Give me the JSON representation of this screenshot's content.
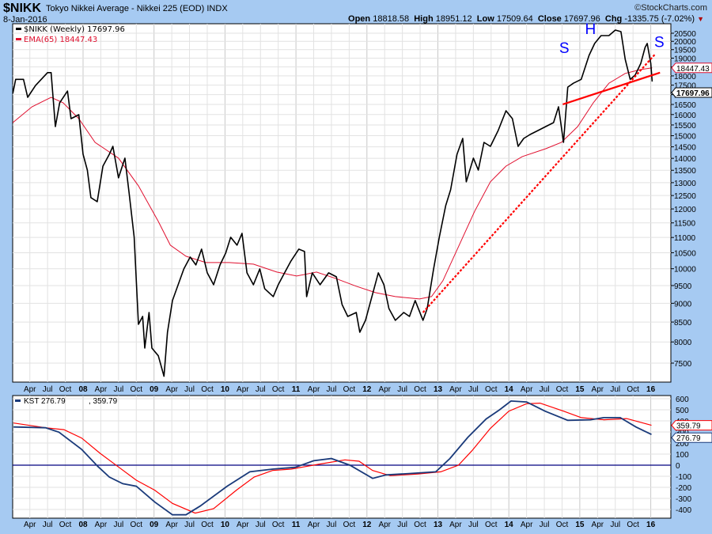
{
  "header": {
    "symbol": "$NIKK",
    "title": "Tokyo Nikkei Average - Nikkei 225 (EOD)  INDX",
    "brand": "©StockCharts.com",
    "date": "8-Jan-2016",
    "open_label": "Open",
    "open": "18818.58",
    "high_label": "High",
    "high": "18951.12",
    "low_label": "Low",
    "low": "17509.64",
    "close_label": "Close",
    "close": "17697.96",
    "chg_label": "Chg",
    "chg": "-1335.75 (-7.02%)",
    "chg_arrow": "▼"
  },
  "colors": {
    "price": "#000000",
    "ema": "#e0102f",
    "kst": "#1a3a7a",
    "kst_signal": "#ff0000",
    "trend": "#ff0000",
    "annot": "#0000ff",
    "frame": "#a6caf2"
  },
  "chart_data": [
    {
      "type": "line",
      "panel": "price",
      "scale": "log",
      "ylim": [
        7100,
        21000
      ],
      "xlim": [
        2007.0,
        2016.28
      ],
      "legend": [
        "$NIKK (Weekly) 17697.96",
        "EMA(65) 18447.43"
      ],
      "y_ticks": [
        "20500",
        "20000",
        "19500",
        "19000",
        "18500",
        "18000",
        "17500",
        "17000",
        "16500",
        "16000",
        "15500",
        "15000",
        "14500",
        "14000",
        "13500",
        "13000",
        "12500",
        "12000",
        "11500",
        "11000",
        "10500",
        "10000",
        "9500",
        "9000",
        "8500",
        "8000",
        "7500"
      ],
      "last_tags": {
        "ema": "18447.43",
        "price": "17697.96"
      },
      "series": [
        {
          "name": "$NIKK (Weekly)",
          "x": [
            2007.01,
            2007.05,
            2007.16,
            2007.22,
            2007.33,
            2007.5,
            2007.55,
            2007.61,
            2007.67,
            2007.78,
            2007.83,
            2007.94,
            2008.0,
            2008.06,
            2008.11,
            2008.2,
            2008.28,
            2008.37,
            2008.42,
            2008.5,
            2008.59,
            2008.65,
            2008.72,
            2008.78,
            2008.84,
            2008.87,
            2008.93,
            2008.97,
            2009.06,
            2009.14,
            2009.19,
            2009.26,
            2009.34,
            2009.42,
            2009.51,
            2009.59,
            2009.67,
            2009.75,
            2009.84,
            2009.93,
            2010.01,
            2010.08,
            2010.17,
            2010.24,
            2010.31,
            2010.4,
            2010.49,
            2010.56,
            2010.68,
            2010.75,
            2010.84,
            2010.93,
            2011.04,
            2011.12,
            2011.15,
            2011.23,
            2011.34,
            2011.46,
            2011.57,
            2011.65,
            2011.73,
            2011.85,
            2011.9,
            2011.98,
            2012.07,
            2012.16,
            2012.24,
            2012.31,
            2012.4,
            2012.52,
            2012.6,
            2012.68,
            2012.79,
            2012.85,
            2012.94,
            2013.02,
            2013.11,
            2013.18,
            2013.27,
            2013.35,
            2013.4,
            2013.5,
            2013.57,
            2013.65,
            2013.74,
            2013.85,
            2013.96,
            2014.05,
            2014.13,
            2014.21,
            2014.3,
            2014.41,
            2014.52,
            2014.63,
            2014.7,
            2014.77,
            2014.83,
            2014.91,
            2015.02,
            2015.13,
            2015.21,
            2015.3,
            2015.41,
            2015.5,
            2015.58,
            2015.64,
            2015.71,
            2015.78,
            2015.86,
            2015.92,
            2015.95,
            2016.0,
            2016.02
          ],
          "y": [
            17065,
            17811,
            17811,
            16861,
            17478,
            18180,
            18180,
            15424,
            16580,
            17188,
            15801,
            15992,
            14176,
            13509,
            12419,
            12270,
            13673,
            14176,
            14522,
            13191,
            14007,
            12570,
            11007,
            8441,
            8647,
            7852,
            8752,
            7852,
            7669,
            7205,
            8240,
            9075,
            9524,
            9995,
            10363,
            10116,
            10616,
            9875,
            9524,
            10116,
            10489,
            11007,
            10745,
            11139,
            9875,
            9524,
            9995,
            9410,
            9185,
            9524,
            9875,
            10239,
            10616,
            10540,
            9185,
            9875,
            9524,
            9875,
            9757,
            8966,
            8647,
            8752,
            8240,
            8544,
            9185,
            9875,
            9524,
            8858,
            8544,
            8752,
            8647,
            9075,
            8544,
            8858,
            9995,
            11007,
            12123,
            12722,
            14176,
            14876,
            13033,
            14007,
            13509,
            14698,
            14522,
            15239,
            16186,
            15801,
            14522,
            14876,
            15057,
            15239,
            15424,
            15611,
            16382,
            14698,
            17394,
            17603,
            17811,
            19163,
            19870,
            20353,
            20353,
            20699,
            20599,
            18933,
            17811,
            18050,
            18702,
            19630,
            19870,
            18702,
            17690
          ]
        },
        {
          "name": "EMA(65)",
          "x": [
            2007.01,
            2007.28,
            2007.55,
            2007.72,
            2007.94,
            2008.17,
            2008.5,
            2008.78,
            2009.06,
            2009.23,
            2009.45,
            2009.73,
            2010.06,
            2010.4,
            2010.73,
            2011.01,
            2011.29,
            2011.57,
            2011.85,
            2012.12,
            2012.4,
            2012.74,
            2012.91,
            2013.07,
            2013.3,
            2013.52,
            2013.74,
            2013.96,
            2014.19,
            2014.52,
            2014.74,
            2014.97,
            2015.19,
            2015.41,
            2015.64,
            2015.86,
            2016.02
          ],
          "y": [
            15611,
            16382,
            16861,
            16580,
            15801,
            14698,
            14007,
            12876,
            11550,
            10745,
            10389,
            10190,
            10190,
            10140,
            9900,
            9780,
            9900,
            9700,
            9480,
            9297,
            9185,
            9119,
            9185,
            9640,
            10745,
            11922,
            13033,
            13673,
            14075,
            14417,
            14698,
            15424,
            16580,
            17603,
            18137,
            18354,
            18447
          ]
        }
      ],
      "annotations": [
        {
          "type": "trendline",
          "style": "solid",
          "x": [
            2014.76,
            2016.13
          ],
          "y": [
            16503,
            18180
          ]
        },
        {
          "type": "trendline",
          "style": "dotted",
          "x": [
            2012.79,
            2016.06
          ],
          "y": [
            8752,
            19226
          ]
        },
        {
          "type": "text",
          "text": "S",
          "x": 2014.78,
          "y": 19300
        },
        {
          "type": "text",
          "text": "H",
          "x": 2015.15,
          "y": 20450
        },
        {
          "type": "text",
          "text": "S",
          "x": 2016.12,
          "y": 19650
        }
      ]
    },
    {
      "type": "line",
      "panel": "kst",
      "ylim": [
        -470,
        640
      ],
      "legend_name": "KST",
      "legend_value1": "276.79",
      "legend_value2": "359.79",
      "y_ticks": [
        "600",
        "500",
        "400",
        "300",
        "200",
        "100",
        "0",
        "-100",
        "-200",
        "-300",
        "-400"
      ],
      "last_tags": {
        "signal": "359.79",
        "kst": "276.79"
      },
      "series": [
        {
          "name": "KST",
          "x": [
            2007.02,
            2007.47,
            2007.66,
            2007.98,
            2008.21,
            2008.37,
            2008.56,
            2008.75,
            2009.01,
            2009.26,
            2009.45,
            2009.65,
            2010.03,
            2010.35,
            2010.67,
            2010.99,
            2011.25,
            2011.5,
            2011.76,
            2012.08,
            2012.27,
            2012.59,
            2012.97,
            2013.17,
            2013.42,
            2013.68,
            2013.87,
            2014.03,
            2014.25,
            2014.51,
            2014.83,
            2015.15,
            2015.34,
            2015.57,
            2015.79,
            2016.01
          ],
          "y": [
            345,
            338,
            298,
            143,
            -12,
            -107,
            -167,
            -190,
            -333,
            -448,
            -448,
            -369,
            -190,
            -60,
            -36,
            -19,
            40,
            60,
            0,
            -119,
            -88,
            -76,
            -60,
            60,
            250,
            417,
            500,
            579,
            571,
            488,
            405,
            410,
            429,
            429,
            345,
            277
          ]
        },
        {
          "name": "Signal",
          "x": [
            2007.02,
            2007.47,
            2007.73,
            2007.98,
            2008.24,
            2008.49,
            2008.75,
            2009.01,
            2009.26,
            2009.58,
            2009.84,
            2010.16,
            2010.41,
            2010.67,
            2010.93,
            2011.31,
            2011.69,
            2011.89,
            2012.08,
            2012.33,
            2012.72,
            2013.04,
            2013.29,
            2013.48,
            2013.74,
            2014.0,
            2014.25,
            2014.44,
            2014.77,
            2015.02,
            2015.34,
            2015.66,
            2016.01
          ],
          "y": [
            381,
            338,
            321,
            245,
            107,
            -12,
            -136,
            -226,
            -345,
            -433,
            -393,
            -226,
            -107,
            -48,
            -36,
            7,
            48,
            36,
            -48,
            -95,
            -79,
            -60,
            0,
            131,
            333,
            488,
            555,
            560,
            488,
            429,
            410,
            421,
            360
          ]
        }
      ]
    }
  ],
  "x_ticks": [
    {
      "label": "Apr",
      "t": 2007.25
    },
    {
      "label": "Jul",
      "t": 2007.5
    },
    {
      "label": "Oct",
      "t": 2007.75
    },
    {
      "label": "08",
      "t": 2008,
      "year": true
    },
    {
      "label": "Apr",
      "t": 2008.25
    },
    {
      "label": "Jul",
      "t": 2008.5
    },
    {
      "label": "Oct",
      "t": 2008.75
    },
    {
      "label": "09",
      "t": 2009,
      "year": true
    },
    {
      "label": "Apr",
      "t": 2009.25
    },
    {
      "label": "Jul",
      "t": 2009.5
    },
    {
      "label": "Oct",
      "t": 2009.75
    },
    {
      "label": "10",
      "t": 2010,
      "year": true
    },
    {
      "label": "Apr",
      "t": 2010.25
    },
    {
      "label": "Jul",
      "t": 2010.5
    },
    {
      "label": "Oct",
      "t": 2010.75
    },
    {
      "label": "11",
      "t": 2011,
      "year": true
    },
    {
      "label": "Apr",
      "t": 2011.25
    },
    {
      "label": "Jul",
      "t": 2011.5
    },
    {
      "label": "Oct",
      "t": 2011.75
    },
    {
      "label": "12",
      "t": 2012,
      "year": true
    },
    {
      "label": "Apr",
      "t": 2012.25
    },
    {
      "label": "Jul",
      "t": 2012.5
    },
    {
      "label": "Oct",
      "t": 2012.75
    },
    {
      "label": "13",
      "t": 2013,
      "year": true
    },
    {
      "label": "Apr",
      "t": 2013.25
    },
    {
      "label": "Jul",
      "t": 2013.5
    },
    {
      "label": "Oct",
      "t": 2013.75
    },
    {
      "label": "14",
      "t": 2014,
      "year": true
    },
    {
      "label": "Apr",
      "t": 2014.25
    },
    {
      "label": "Jul",
      "t": 2014.5
    },
    {
      "label": "Oct",
      "t": 2014.75
    },
    {
      "label": "15",
      "t": 2015,
      "year": true
    },
    {
      "label": "Apr",
      "t": 2015.25
    },
    {
      "label": "Jul",
      "t": 2015.5
    },
    {
      "label": "Oct",
      "t": 2015.75
    },
    {
      "label": "16",
      "t": 2016,
      "year": true
    }
  ]
}
